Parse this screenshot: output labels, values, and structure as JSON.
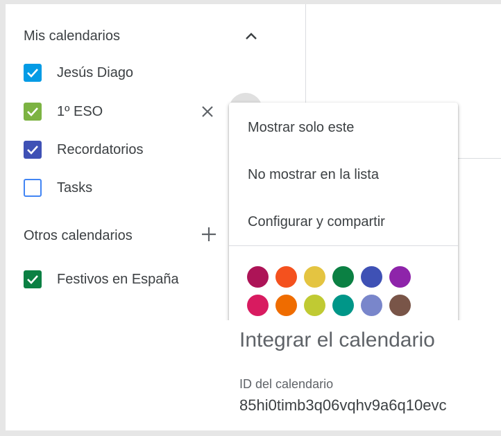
{
  "sidebar": {
    "my_calendars": {
      "title": "Mis calendarios",
      "items": [
        {
          "label": "Jesús Diago",
          "checked": true,
          "color": "#039be5"
        },
        {
          "label": "1º ESO",
          "checked": true,
          "color": "#7cb342"
        },
        {
          "label": "Recordatorios",
          "checked": true,
          "color": "#3f51b5"
        },
        {
          "label": "Tasks",
          "checked": false,
          "color": "#4285f4"
        }
      ]
    },
    "other_calendars": {
      "title": "Otros calendarios",
      "items": [
        {
          "label": "Festivos en España",
          "checked": true,
          "color": "#0b8043"
        }
      ]
    }
  },
  "context_menu": {
    "items": [
      {
        "label": "Mostrar solo este"
      },
      {
        "label": "No mostrar en la lista"
      },
      {
        "label": "Configurar y compartir"
      }
    ],
    "colors": [
      [
        "#ad1457",
        "#f4511e",
        "#e4c441",
        "#0b8043",
        "#3f51b5",
        "#8e24aa"
      ],
      [
        "#d81b60",
        "#ef6c00",
        "#c0ca33",
        "#009688",
        "#7986cb",
        "#795548"
      ]
    ]
  },
  "settings_panel": {
    "title": "Integrar el calendario",
    "id_label": "ID del calendario",
    "id_value": "85hi0timb3q06vqhv9a6q10evc"
  },
  "icons": {
    "collapse": "chevron-up-icon",
    "add": "plus-icon",
    "remove": "close-icon",
    "check": "check-icon"
  }
}
